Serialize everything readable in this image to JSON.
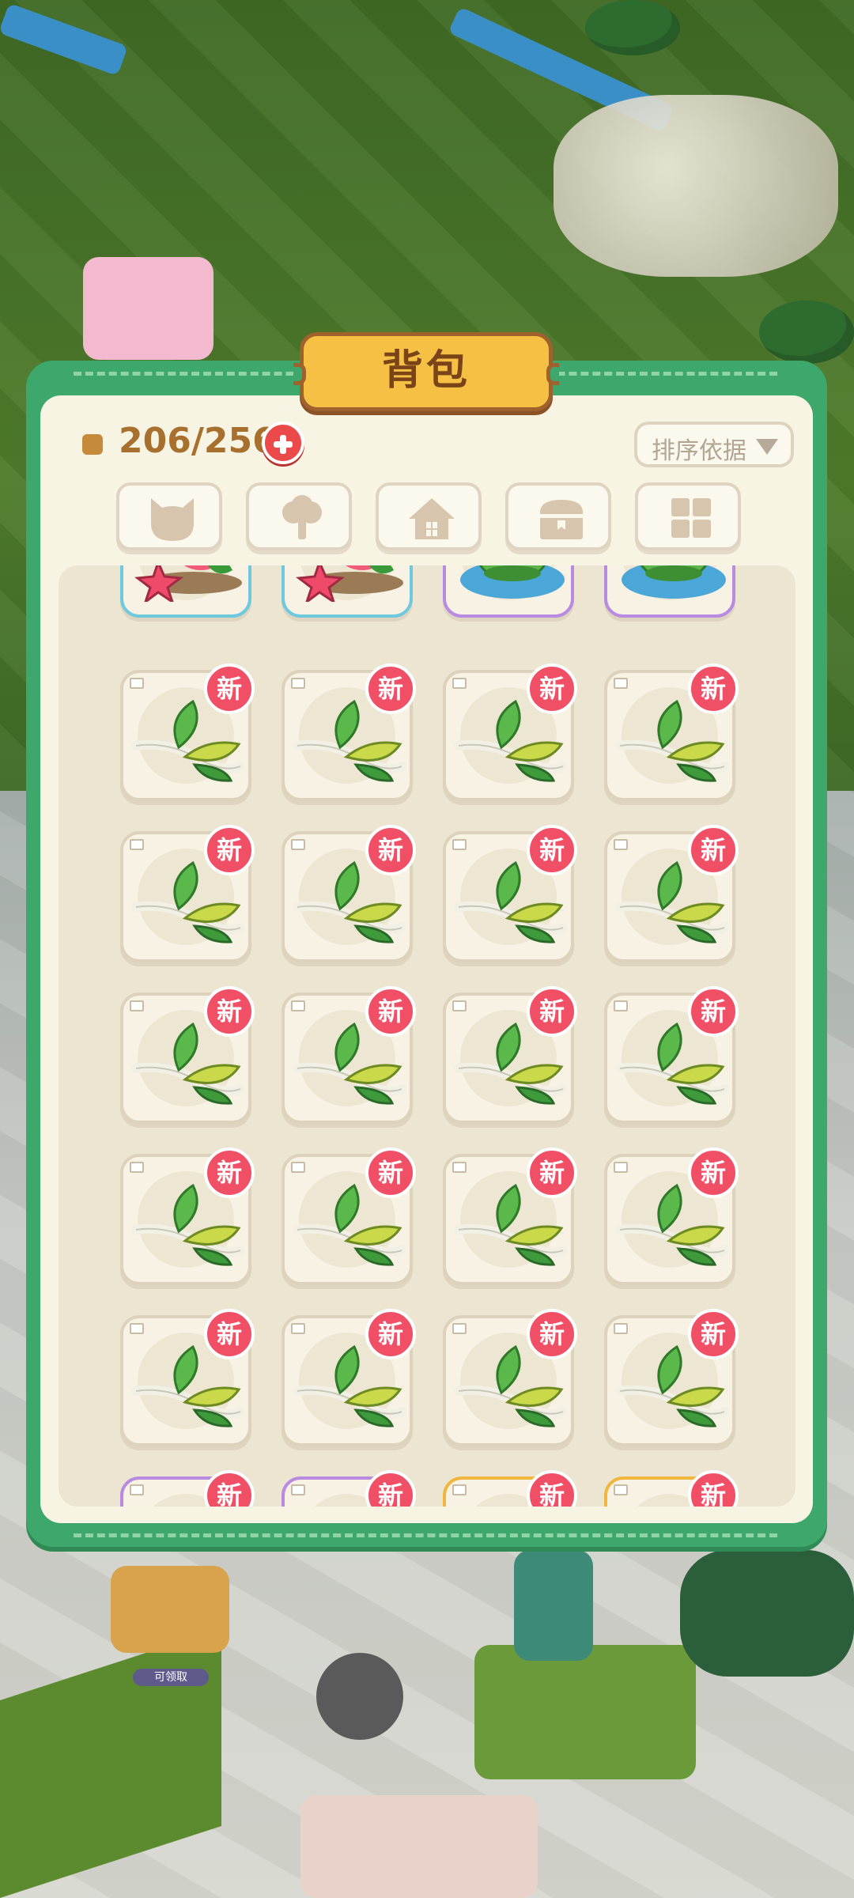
{
  "panel": {
    "title": "背包",
    "capacity": "206/256",
    "sort_label": "排序依据"
  },
  "tabs": [
    {
      "name": "pet-tab",
      "icon": "cat-icon"
    },
    {
      "name": "plant-tab",
      "icon": "tree-icon"
    },
    {
      "name": "building-tab",
      "icon": "house-icon"
    },
    {
      "name": "chest-tab",
      "icon": "chest-icon"
    },
    {
      "name": "all-tab",
      "icon": "grid-icon"
    }
  ],
  "items": {
    "badge_label": "新",
    "rows": [
      [
        "strawberry-decoration",
        "strawberry-decoration",
        "tree-island",
        "tree-island"
      ],
      [
        "leaf-branch",
        "leaf-branch",
        "leaf-branch",
        "leaf-branch"
      ],
      [
        "leaf-branch",
        "leaf-branch",
        "leaf-branch",
        "leaf-branch"
      ],
      [
        "leaf-branch",
        "leaf-branch",
        "leaf-branch",
        "leaf-branch"
      ],
      [
        "leaf-branch",
        "leaf-branch",
        "leaf-branch",
        "leaf-branch"
      ],
      [
        "leaf-branch",
        "leaf-branch",
        "leaf-branch",
        "leaf-branch"
      ],
      [
        "unknown-item",
        "unknown-item",
        "unknown-item",
        "unknown-item"
      ]
    ]
  },
  "background": {
    "claim_label": "可领取"
  },
  "colors": {
    "panel_green": "#3ea86c",
    "title_gold": "#f5c043",
    "badge_red": "#f14f66",
    "add_red": "#ec4a4a"
  }
}
